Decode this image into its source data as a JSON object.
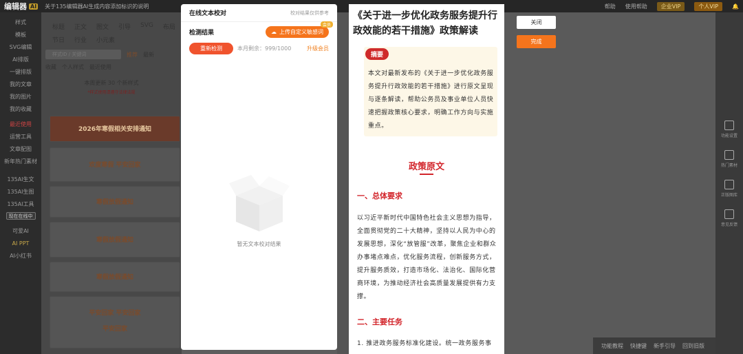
{
  "topbar": {
    "logo_text": "编辑器",
    "logo_badge": "AI",
    "notice": "关于135编辑器AI生成内容添加标识的说明",
    "items": [
      "帮助",
      "使用帮助"
    ],
    "vip1": "企业VIP",
    "vip2": "个人VIP"
  },
  "sidebar": {
    "items": [
      "样式",
      "模板",
      "SVG编辑",
      "AI排版",
      "一键排版",
      "我的文章",
      "我的图片",
      "我的收藏"
    ],
    "recent": "最近使用",
    "items2": [
      "运营工具",
      "文章配图",
      "新年热门素材"
    ],
    "items3": [
      "135AI生文",
      "135AI生图",
      "135AI工具"
    ],
    "chip": "现在在线中",
    "items4": [
      "可爱AI",
      "AI PPT",
      "AI小红书"
    ]
  },
  "panel": {
    "tabs1": [
      "标题",
      "正文",
      "图文",
      "引导",
      "SVG",
      "布局"
    ],
    "tabs2": [
      "节日",
      "行业",
      "小元素"
    ],
    "search_placeholder": "样式ID / 关键词",
    "filters": [
      "推荐",
      "最新"
    ],
    "links": [
      "收藏",
      "个人样式",
      "最近使用"
    ],
    "notice": "本周更新 30 个新样式",
    "notice2": "*样式使用请遵守法律法规",
    "cards": [
      "2026年寒假相关安排通知",
      "欢度寒假 平安回家",
      "寒假放假通知",
      "寒假放假通知",
      "寒假放假通知",
      "平安回家 平安回家",
      "平安回家"
    ]
  },
  "checker": {
    "title": "在线文本校对",
    "note": "校对结果仅供参考",
    "result_label": "检测结果",
    "upload_label": "上传自定义敏感词",
    "upload_badge": "会员",
    "recheck_label": "重新检测",
    "remain": "本月剩余：999/1000",
    "upgrade": "升级会员",
    "empty_text": "暂无文本校对结果"
  },
  "doc": {
    "title": "《关于进一步优化政务服务提升行政效能的若干措施》政策解读",
    "summary_tag": "摘要",
    "summary": "本文对最新发布的《关于进一步优化政务服务提升行政效能的若干措施》进行原文呈现与逐条解读，帮助公务员及事业单位人员快速把握政策核心要求，明确工作方向与实施重点。",
    "original_title": "政策原文",
    "sec1": "一、总体要求",
    "para1": "以习近平新时代中国特色社会主义思想为指导，全面贯彻党的二十大精神，坚持以人民为中心的发展思想，深化“放管服”改革，聚焦企业和群众办事堵点难点，优化服务流程，创新服务方式，提升服务质效，打造市场化、法治化、国际化营商环境，为推动经济社会高质量发展提供有力支撑。",
    "sec2": "二、主要任务",
    "para2": "1. 推进政务服务标准化建设。统一政务服务事"
  },
  "actions": {
    "close": "关闭",
    "done": "完成"
  },
  "rightbar": {
    "items": [
      "功能设置",
      "热门素材",
      "正版图库",
      "意见反馈"
    ]
  },
  "bottombar": {
    "items": [
      "功能教程",
      "快捷键",
      "新手引导",
      "回到旧版"
    ]
  },
  "colors": {
    "accent": "#f5741c",
    "red": "#d2242a",
    "summary_bg": "#fdf7e7"
  }
}
